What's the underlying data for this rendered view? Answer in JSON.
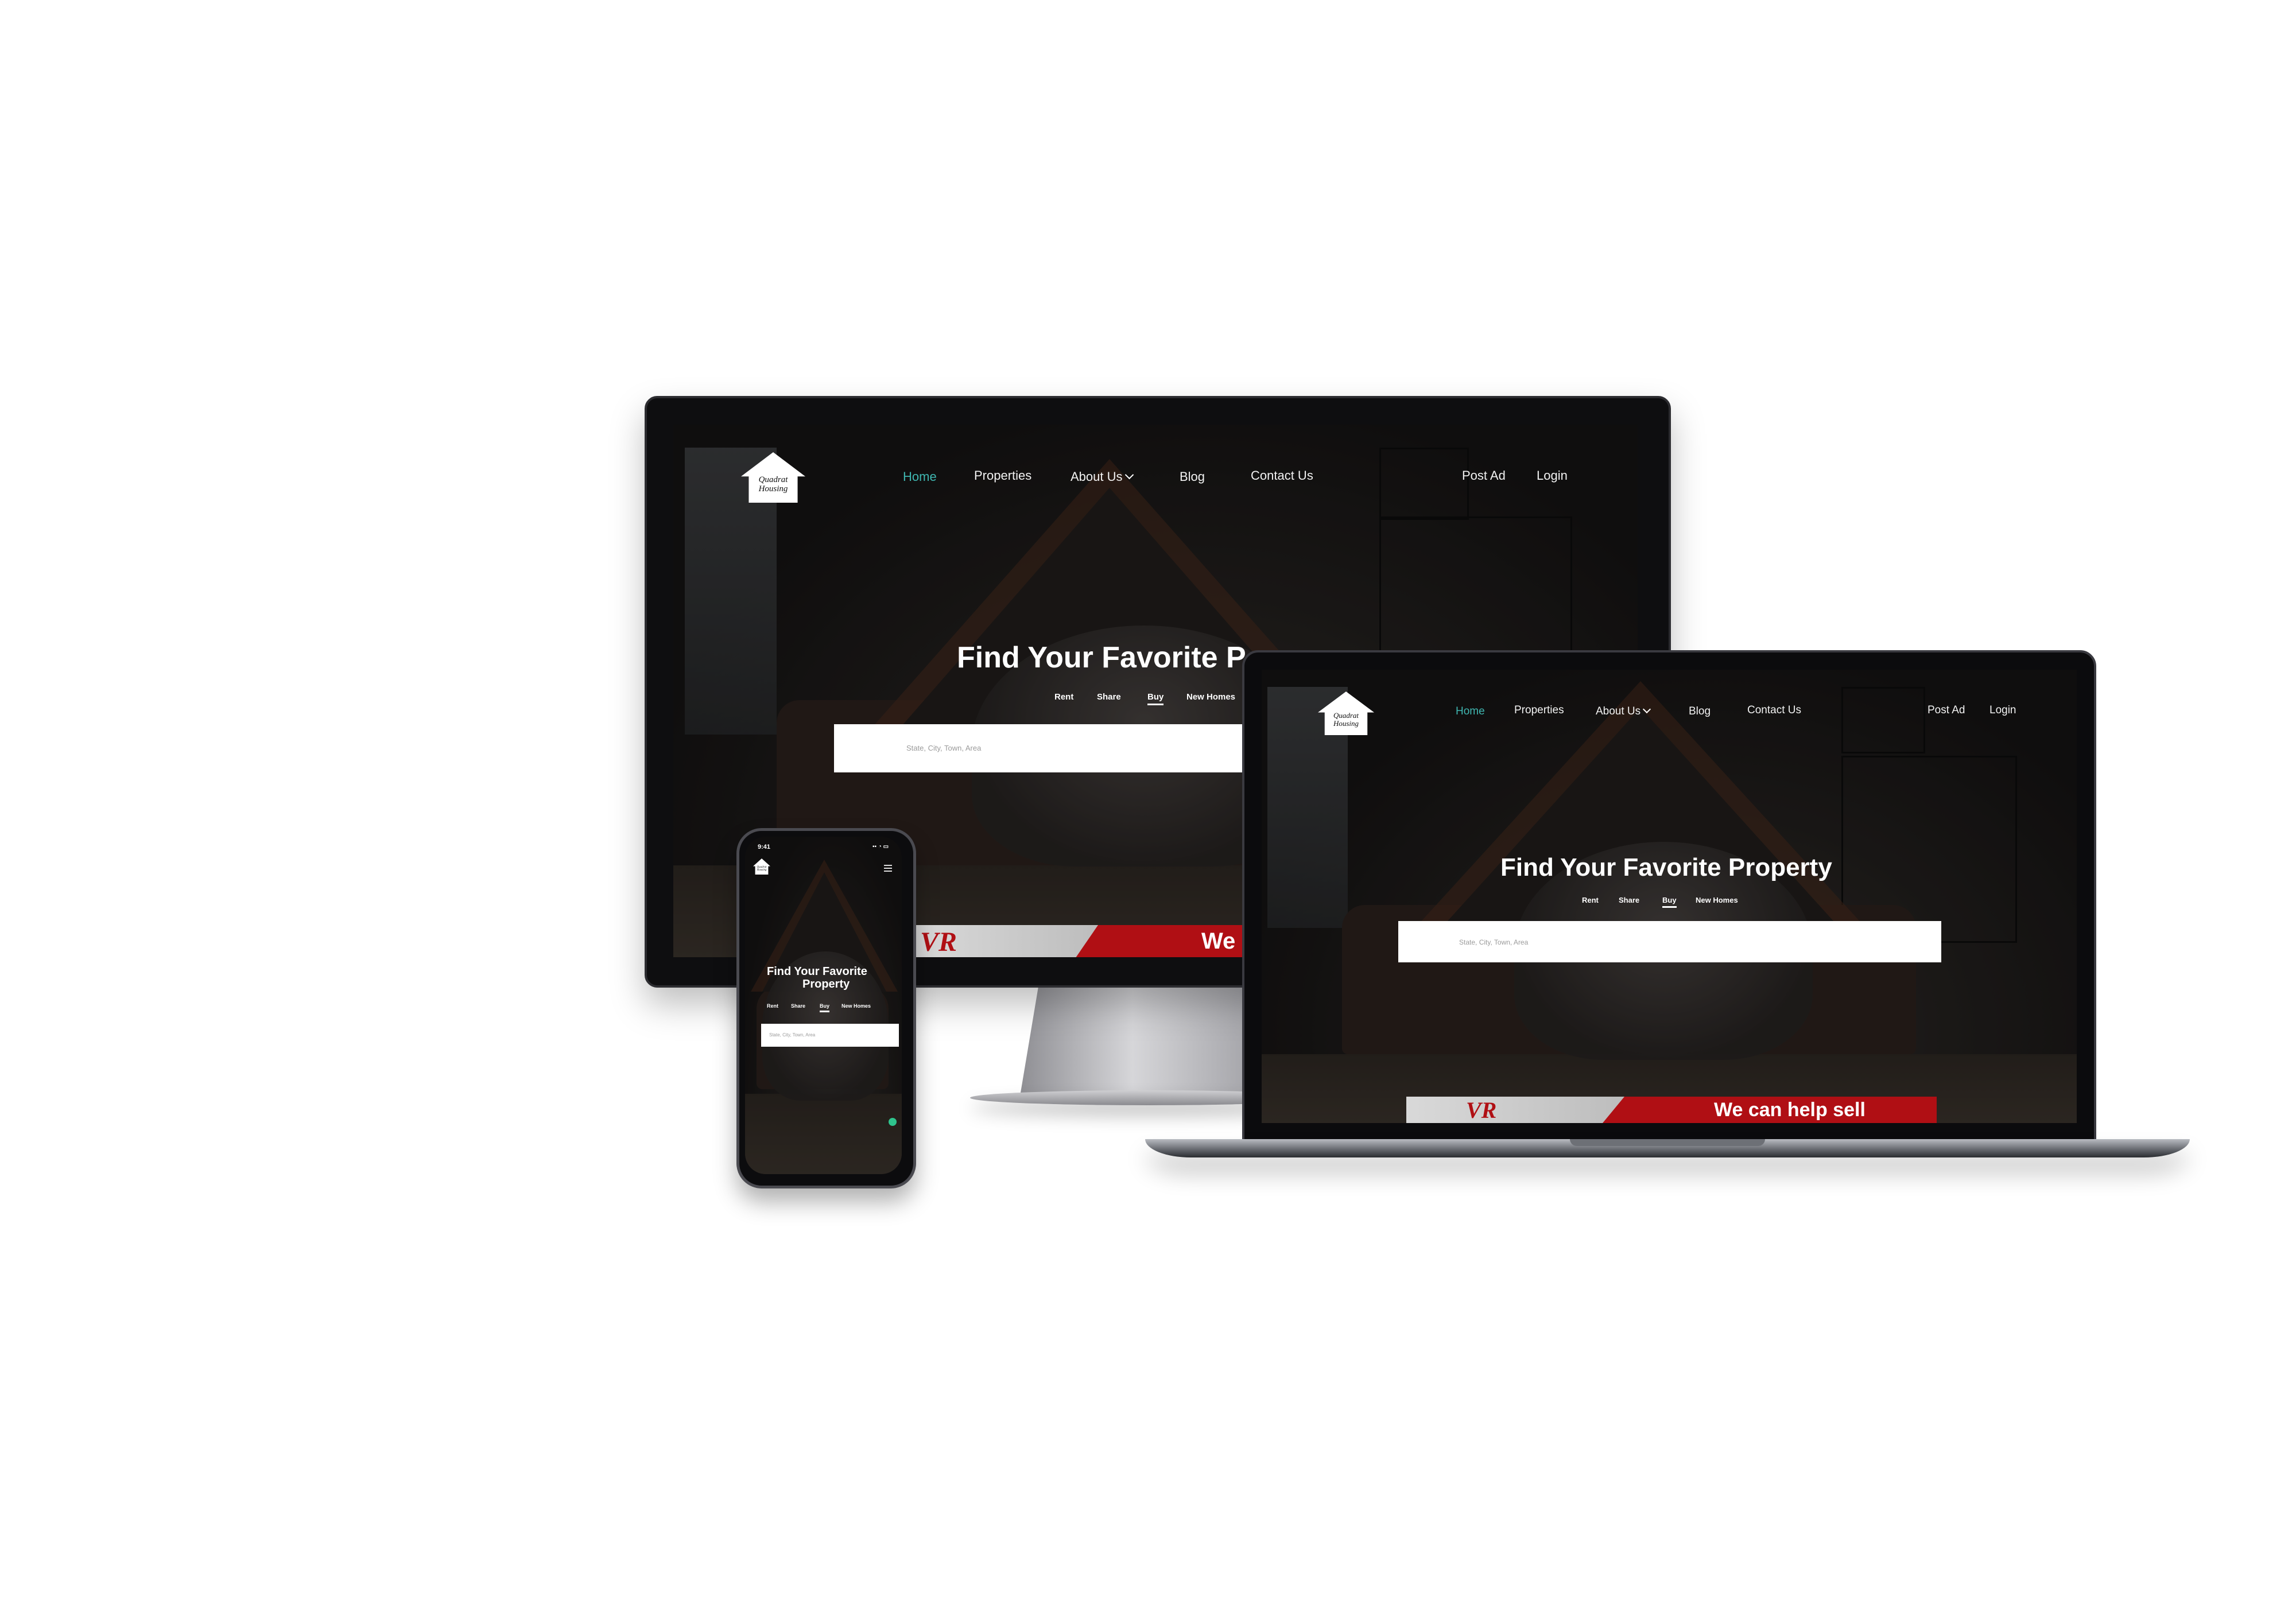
{
  "site": {
    "logo_line1": "Quadrat",
    "logo_line2": "Housing",
    "nav": {
      "home": "Home",
      "properties": "Properties",
      "about": "About Us",
      "blog": "Blog",
      "contact": "Contact Us",
      "post_ad": "Post Ad",
      "login": "Login"
    },
    "headline": "Find Your Favorite Property",
    "headline_monitor_visible": "Find Your Favorite P",
    "headline_phone_line1": "Find Your Favorite",
    "headline_phone_line2": "Property",
    "tabs": {
      "rent": "Rent",
      "share": "Share",
      "buy": "Buy",
      "new_homes": "New Homes"
    },
    "active_tab": "Buy",
    "search_placeholder": "State, City, Town, Area",
    "banner_text": "We can help sell",
    "banner_text_monitor_visible": "We",
    "banner_logo": "VR"
  },
  "phone": {
    "time": "9:41"
  },
  "colors": {
    "active_nav": "#3fb6b0",
    "banner_red": "#b00f14",
    "fab_green": "#2fc48d"
  }
}
